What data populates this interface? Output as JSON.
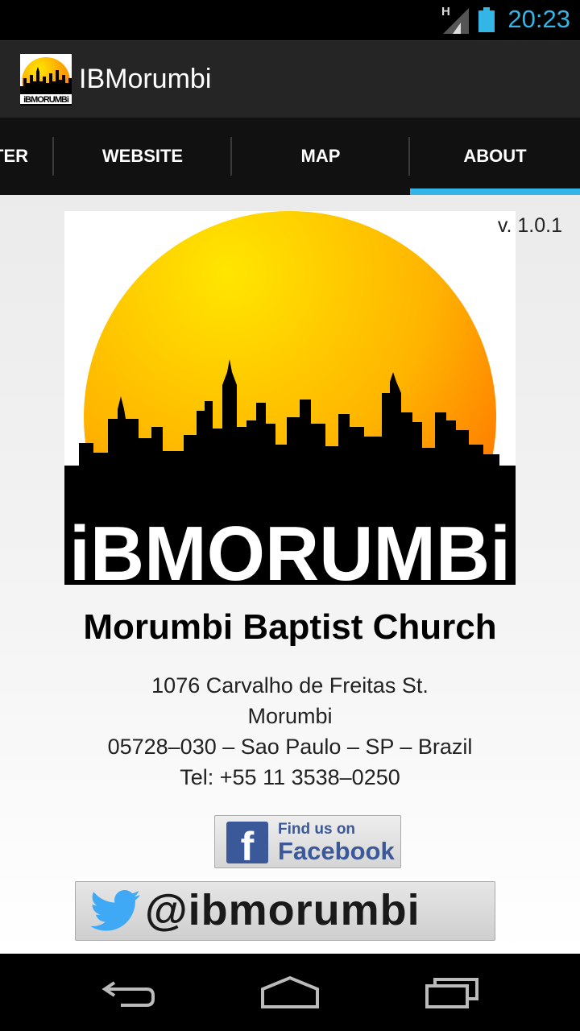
{
  "status_bar": {
    "network_type": "H",
    "time": "20:23",
    "icons": [
      "signal-icon",
      "battery-icon"
    ]
  },
  "action_bar": {
    "app_icon": "ibmorumbi-logo-icon",
    "title": "IBMorumbi"
  },
  "tabs": [
    {
      "label": "TER",
      "selected": false
    },
    {
      "label": "WEBSITE",
      "selected": false
    },
    {
      "label": "MAP",
      "selected": false
    },
    {
      "label": "ABOUT",
      "selected": true
    }
  ],
  "about": {
    "version": "v. 1.0.1",
    "logo_wordmark": "iBMORUMBi",
    "church_name": "Morumbi Baptist Church",
    "address_lines": [
      "1076 Carvalho de Freitas St.",
      "Morumbi",
      "05728–030 – Sao Paulo – SP – Brazil",
      "Tel: +55 11 3538–0250"
    ],
    "facebook": {
      "line1": "Find us on",
      "line2": "Facebook",
      "logo_letter": "f"
    },
    "twitter": {
      "handle": "@ibmorumbi"
    }
  },
  "nav_bar": {
    "buttons": [
      "back-icon",
      "home-icon",
      "recent-apps-icon"
    ]
  },
  "colors": {
    "accent": "#33b5e5",
    "facebook_blue": "#3b5998",
    "twitter_blue": "#3fa9f5",
    "sun_yellow": "#ffe600",
    "sun_orange": "#ff7a00"
  }
}
